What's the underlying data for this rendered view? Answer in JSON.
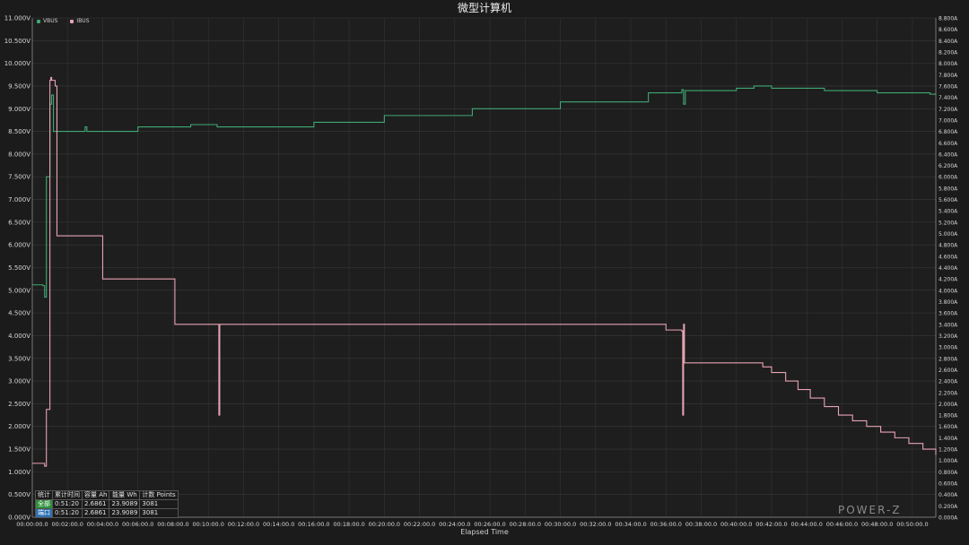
{
  "chart_data": {
    "type": "line",
    "title": "微型计算机",
    "xlabel": "Elapsed Time",
    "x_ticks": [
      "00:00:00.0",
      "00:02:00.0",
      "00:04:00.0",
      "00:06:00.0",
      "00:08:00.0",
      "00:10:00.0",
      "00:12:00.0",
      "00:14:00.0",
      "00:16:00.0",
      "00:18:00.0",
      "00:20:00.0",
      "00:22:00.0",
      "00:24:00.0",
      "00:26:00.0",
      "00:28:00.0",
      "00:30:00.0",
      "00:32:00.0",
      "00:34:00.0",
      "00:36:00.0",
      "00:38:00.0",
      "00:40:00.0",
      "00:42:00.0",
      "00:44:00.0",
      "00:46:00.0",
      "00:48:00.0",
      "00:50:00.0"
    ],
    "xlim_minutes": [
      0,
      51.33
    ],
    "y_left_ticks": [
      "0.000V",
      "0.500V",
      "1.000V",
      "1.500V",
      "2.000V",
      "2.500V",
      "3.000V",
      "3.500V",
      "4.000V",
      "4.500V",
      "5.000V",
      "5.500V",
      "6.000V",
      "6.500V",
      "7.000V",
      "7.500V",
      "8.000V",
      "8.500V",
      "9.000V",
      "9.500V",
      "10.000V",
      "10.500V",
      "11.000V"
    ],
    "y_left_range": [
      0,
      11
    ],
    "y_right_ticks": [
      "0.000A",
      "0.200A",
      "0.400A",
      "0.600A",
      "0.800A",
      "1.000A",
      "1.200A",
      "1.400A",
      "1.600A",
      "1.800A",
      "2.000A",
      "2.200A",
      "2.400A",
      "2.600A",
      "2.800A",
      "3.000A",
      "3.200A",
      "3.400A",
      "3.600A",
      "3.800A",
      "4.000A",
      "4.200A",
      "4.400A",
      "4.600A",
      "4.800A",
      "5.000A",
      "5.200A",
      "5.400A",
      "5.600A",
      "5.800A",
      "6.000A",
      "6.200A",
      "6.400A",
      "6.600A",
      "6.800A",
      "7.000A",
      "7.200A",
      "7.400A",
      "7.600A",
      "7.800A",
      "8.000A",
      "8.200A",
      "8.400A",
      "8.600A",
      "8.800A"
    ],
    "y_right_range": [
      0,
      8.8
    ],
    "grid": true,
    "legend_position": "top-left",
    "series": [
      {
        "name": "VBUS",
        "color": "#3fa873",
        "axis": "left",
        "x": [
          0,
          0.6,
          0.7,
          0.8,
          1.0,
          1.1,
          1.2,
          3.0,
          3.1,
          6.0,
          9.0,
          10.5,
          16.0,
          20.0,
          25.0,
          30.0,
          35.0,
          36.9,
          37.0,
          37.1,
          40.0,
          41.0,
          42.0,
          45.0,
          48.0,
          51.0,
          51.33
        ],
        "values": [
          5.12,
          5.1,
          4.85,
          7.5,
          9.1,
          9.3,
          8.5,
          8.6,
          8.5,
          8.6,
          8.65,
          8.6,
          8.7,
          8.85,
          9.0,
          9.15,
          9.35,
          9.42,
          9.1,
          9.4,
          9.45,
          9.5,
          9.45,
          9.4,
          9.35,
          9.32,
          9.3
        ]
      },
      {
        "name": "IBUS",
        "color": "#e7a3b4",
        "axis": "right",
        "x": [
          0,
          0.7,
          0.8,
          1.0,
          1.05,
          1.1,
          1.3,
          1.4,
          3.9,
          4.0,
          8.0,
          8.1,
          10.5,
          10.6,
          10.65,
          10.7,
          35.0,
          36.0,
          36.9,
          36.95,
          37.0,
          37.05,
          37.1,
          41.0,
          41.5,
          42.0,
          42.8,
          43.5,
          44.2,
          45.0,
          45.8,
          46.6,
          47.4,
          48.2,
          49.0,
          49.8,
          50.6,
          51.33
        ],
        "values": [
          0.95,
          0.9,
          1.9,
          7.7,
          7.75,
          7.7,
          7.6,
          4.96,
          4.96,
          4.2,
          4.2,
          3.4,
          3.4,
          1.8,
          3.4,
          3.4,
          3.4,
          3.3,
          3.28,
          1.8,
          3.4,
          2.72,
          2.72,
          2.72,
          2.65,
          2.55,
          2.4,
          2.25,
          2.1,
          1.95,
          1.8,
          1.7,
          1.6,
          1.5,
          1.4,
          1.3,
          1.2,
          1.1
        ]
      }
    ]
  },
  "stats_table": {
    "headers": [
      "统计",
      "累计时间",
      "容量 Ah",
      "能量 Wh",
      "计数 Points"
    ],
    "rows": [
      {
        "tag": "全部",
        "time": "0:51:20",
        "ah": "2.6861",
        "wh": "23.9089",
        "points": "3081"
      },
      {
        "tag": "端口",
        "time": "0:51:20",
        "ah": "2.6861",
        "wh": "23.9089",
        "points": "3081"
      }
    ]
  },
  "watermark": "POWER-Z"
}
